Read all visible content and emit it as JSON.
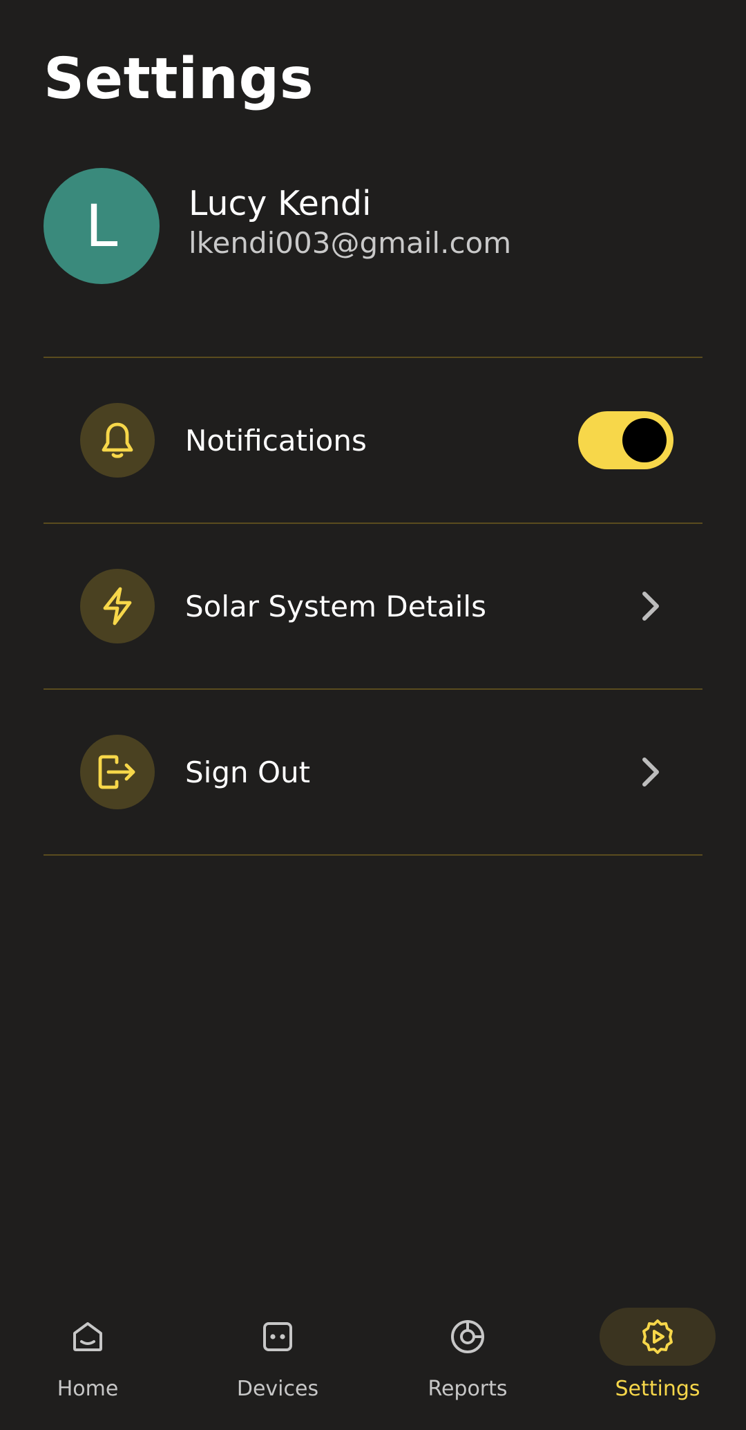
{
  "page": {
    "title": "Settings"
  },
  "profile": {
    "initial": "L",
    "name": "Lucy Kendi",
    "email": "lkendi003@gmail.com",
    "avatar_color": "#3a8a7c"
  },
  "settings": {
    "items": [
      {
        "label": "Notifications",
        "icon": "bell-icon",
        "control": "toggle",
        "toggle_on": true
      },
      {
        "label": "Solar System Details",
        "icon": "lightning-icon",
        "control": "chevron"
      },
      {
        "label": "Sign Out",
        "icon": "sign-out-icon",
        "control": "chevron"
      }
    ]
  },
  "bottom_nav": {
    "items": [
      {
        "label": "Home",
        "icon": "home-icon",
        "active": false
      },
      {
        "label": "Devices",
        "icon": "devices-icon",
        "active": false
      },
      {
        "label": "Reports",
        "icon": "reports-icon",
        "active": false
      },
      {
        "label": "Settings",
        "icon": "settings-gear-icon",
        "active": true
      }
    ]
  },
  "colors": {
    "background": "#1f1e1d",
    "accent": "#f7d74a",
    "icon_bg": "#4a4121",
    "divider": "#5a4c1e"
  }
}
